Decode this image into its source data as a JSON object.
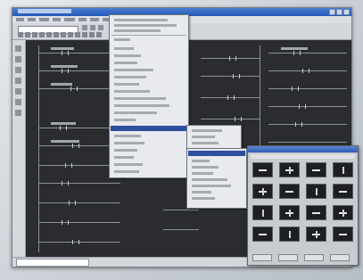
{
  "window": {
    "title": ""
  },
  "menus": {
    "main_menu_open": true,
    "submenu_1_open": true,
    "submenu_2_open": true
  },
  "palette": {
    "visible": true
  },
  "statusbar": {
    "text": ""
  },
  "colors": {
    "canvas": "#2a2c30",
    "titlebar": "#2458b8",
    "menu_highlight": "#2c4fa0",
    "chrome": "#d3d6db"
  }
}
